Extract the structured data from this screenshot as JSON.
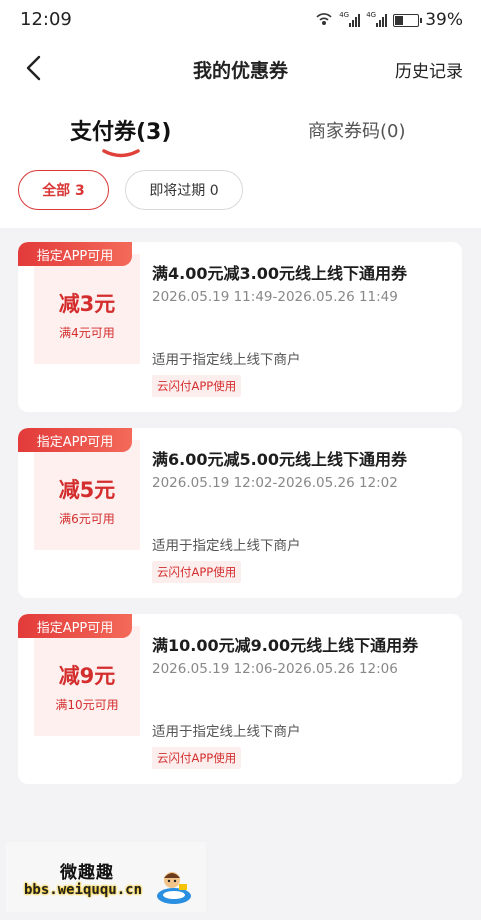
{
  "status_bar": {
    "time": "12:09",
    "network_label": "4G",
    "battery_percent_text": "39%",
    "battery_level": 0.39,
    "icons": [
      "hotspot-icon",
      "signal-icon",
      "signal-icon",
      "battery-icon"
    ]
  },
  "nav": {
    "back_icon": "chevron-left-icon",
    "title": "我的优惠券",
    "history_label": "历史记录"
  },
  "tabs": [
    {
      "label": "支付券(3)",
      "active": true
    },
    {
      "label": "商家券码(0)",
      "active": false
    }
  ],
  "filters": [
    {
      "label": "全部 3",
      "active": true
    },
    {
      "label": "即将过期 0",
      "active": false
    }
  ],
  "coupons": [
    {
      "tag": "指定APP可用",
      "amount": "减3元",
      "condition": "满4元可用",
      "title": "满4.00元减3.00元线上线下通用券",
      "period": "2026.05.19 11:49-2026.05.26 11:49",
      "scope": "适用于指定线上线下商户",
      "badge": "云闪付APP使用"
    },
    {
      "tag": "指定APP可用",
      "amount": "减5元",
      "condition": "满6元可用",
      "title": "满6.00元减5.00元线上线下通用券",
      "period": "2026.05.19 12:02-2026.05.26 12:02",
      "scope": "适用于指定线上线下商户",
      "badge": "云闪付APP使用"
    },
    {
      "tag": "指定APP可用",
      "amount": "减9元",
      "condition": "满10元可用",
      "title": "满10.00元减9.00元线上线下通用券",
      "period": "2026.05.19 12:06-2026.05.26 12:06",
      "scope": "适用于指定线上线下商户",
      "badge": "云闪付APP使用"
    }
  ],
  "watermark": {
    "title": "微趣趣",
    "url": "bbs.weiququ.cn"
  },
  "colors": {
    "accent": "#d93737",
    "coupon_bg": "#fdf0ef",
    "page_bg": "#f3f3f5"
  }
}
